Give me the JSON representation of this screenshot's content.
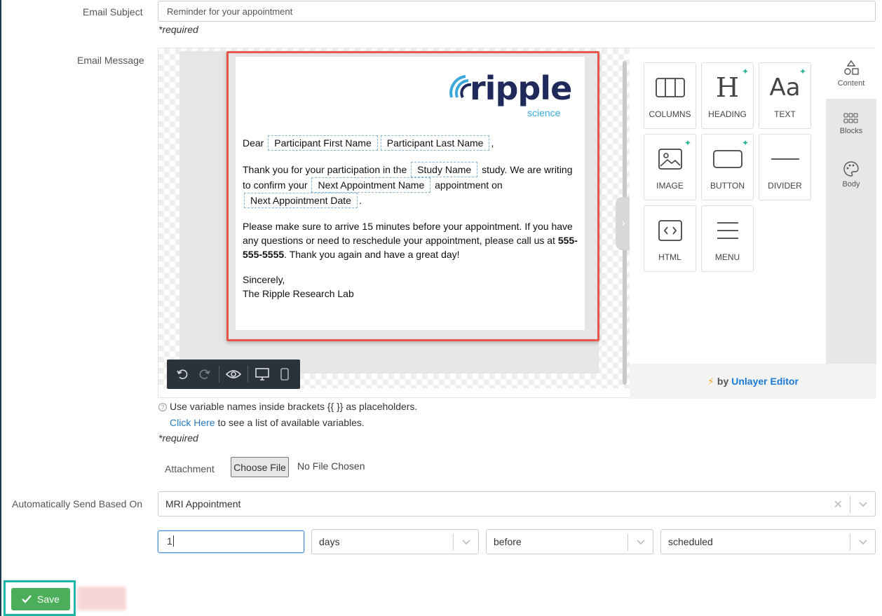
{
  "form": {
    "subject_label": "Email Subject",
    "subject_value": "Reminder for your appointment",
    "required": "*required",
    "message_label": "Email Message",
    "attachment_label": "Attachment",
    "choose_file": "Choose File",
    "no_file": "No File Chosen",
    "auto_send_label": "Automatically Send Based On",
    "auto_send_value": "MRI Appointment",
    "offset_value": "1",
    "unit_value": "days",
    "relation_value": "before",
    "status_value": "scheduled",
    "save_label": "Save"
  },
  "hint": {
    "line1": "Use variable names inside brackets {{ }} as placeholders.",
    "link": "Click Here",
    "line2": " to see a list of available variables."
  },
  "email": {
    "logo_word": "ripple",
    "logo_sub": "science",
    "greeting": "Dear",
    "tag_first_name": "Participant First Name",
    "tag_last_name": "Participant Last Name",
    "comma": ",",
    "p1_a": "Thank you for your participation in the",
    "tag_study": "Study Name",
    "p1_b": "study. We are writing to confirm your",
    "tag_appt_name": "Next Appointment Name",
    "p1_c": "appointment on",
    "tag_appt_date": "Next Appointment Date",
    "period": ".",
    "p2_a": "Please make sure to arrive 15 minutes before your appointment. If you have any questions or need to reschedule your appointment, please call us at",
    "phone": "555-555-5555",
    "p2_b": ". Thank you again and have a great day!",
    "sign1": "Sincerely,",
    "sign2": "The Ripple Research Lab"
  },
  "editor": {
    "tools": [
      "COLUMNS",
      "HEADING",
      "TEXT",
      "IMAGE",
      "BUTTON",
      "DIVIDER",
      "HTML",
      "MENU"
    ],
    "tabs": [
      "Content",
      "Blocks",
      "Body"
    ],
    "powered_by": "by",
    "powered_name": "Unlayer Editor"
  },
  "colors": {
    "highlight": "#e8564a",
    "save": "#4bae5a",
    "focus_ring": "#1fb6a6",
    "link": "#2a7ac2"
  }
}
